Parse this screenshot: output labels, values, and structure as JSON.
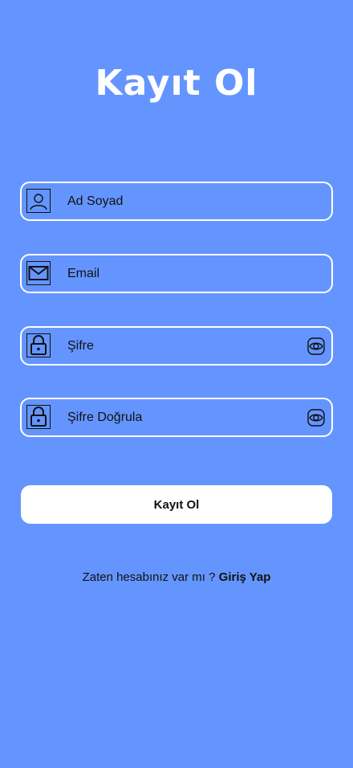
{
  "header": {
    "title": "Kayıt Ol"
  },
  "form": {
    "fields": [
      {
        "icon": "user-icon",
        "label": "Ad Soyad"
      },
      {
        "icon": "mail-icon",
        "label": "Email"
      },
      {
        "icon": "lock-icon",
        "label": "Şifre",
        "trailing_icon": "eye-icon"
      },
      {
        "icon": "lock-icon",
        "label": "Şifre Doğrula",
        "trailing_icon": "eye-icon"
      }
    ],
    "submit_label": "Kayıt Ol"
  },
  "footer": {
    "prompt": "Zaten hesabınız var mı ?",
    "link_label": "Giriş Yap"
  },
  "colors": {
    "background": "#6495ff",
    "field_border": "#ffffff",
    "button_background": "#ffffff",
    "text": "#111111"
  }
}
